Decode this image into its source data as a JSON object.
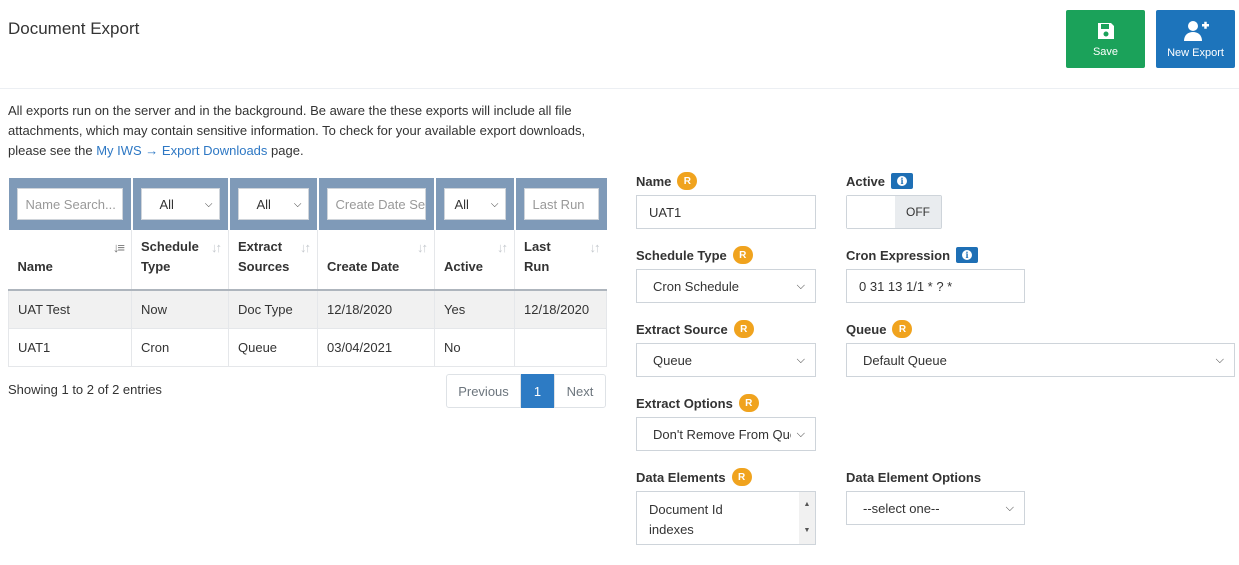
{
  "page": {
    "title": "Document Export",
    "intro_text": "All exports run on the server and in the background. Be aware the these exports will include all file attachments, which may contain sensitive information. To check for your available export downloads, please see the ",
    "intro_link": "My IWS → Export Downloads",
    "intro_suffix": " page."
  },
  "toolbar": {
    "save_label": "Save",
    "new_export_label": "New Export"
  },
  "table": {
    "filters": {
      "name_placeholder": "Name Search...",
      "schedule_value": "All",
      "extract_value": "All",
      "create_date_placeholder": "Create Date Search",
      "active_value": "All",
      "last_run_placeholder": "Last Run"
    },
    "columns": [
      {
        "line1": "",
        "line2": "Name"
      },
      {
        "line1": "Schedule",
        "line2": "Type"
      },
      {
        "line1": "Extract",
        "line2": "Sources"
      },
      {
        "line1": "",
        "line2": "Create Date"
      },
      {
        "line1": "",
        "line2": "Active"
      },
      {
        "line1": "Last",
        "line2": "Run"
      }
    ],
    "rows": [
      [
        "UAT Test",
        "Now",
        "Doc Type",
        "12/18/2020",
        "Yes",
        "12/18/2020"
      ],
      [
        "UAT1",
        "Cron",
        "Queue",
        "03/04/2021",
        "No",
        ""
      ]
    ],
    "showing": "Showing 1 to 2 of 2 entries",
    "pager": {
      "prev": "Previous",
      "current": "1",
      "next": "Next"
    }
  },
  "form": {
    "required_badge": "R",
    "info_badge": "i",
    "name_label": "Name",
    "name_value": "UAT1",
    "active_label": "Active",
    "active_state": "OFF",
    "schedule_type_label": "Schedule Type",
    "schedule_type_value": "Cron Schedule",
    "cron_label": "Cron Expression",
    "cron_value": "0 31 13 1/1 * ? *",
    "extract_source_label": "Extract Source",
    "extract_source_value": "Queue",
    "queue_label": "Queue",
    "queue_value": "Default Queue",
    "extract_options_label": "Extract Options",
    "extract_options_value": "Don't Remove From Queue",
    "data_elements_label": "Data Elements",
    "data_elements_items": [
      "Document Id",
      "indexes"
    ],
    "data_element_options_label": "Data Element Options",
    "data_element_options_value": "--select one--"
  }
}
